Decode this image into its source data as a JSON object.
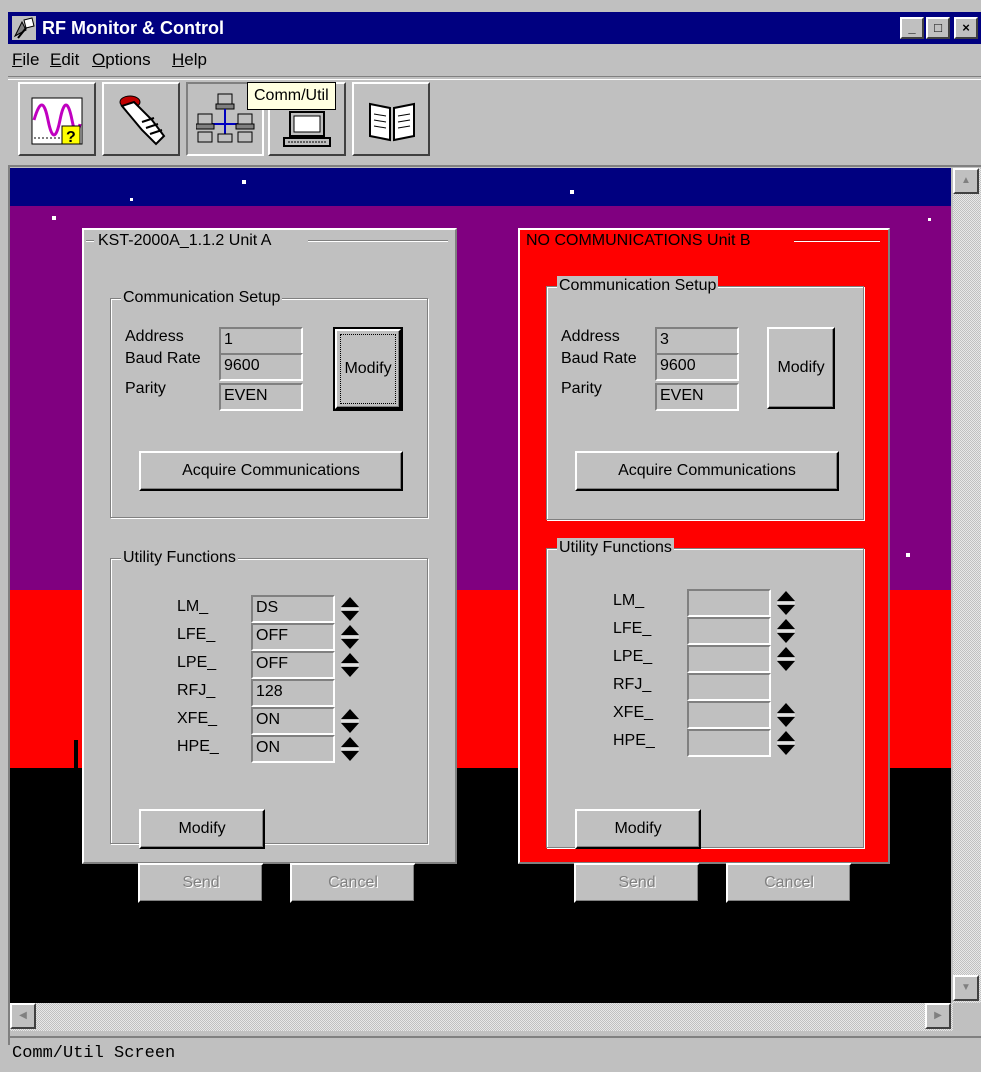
{
  "window": {
    "title": "RF Monitor & Control",
    "min_glyph": "_",
    "max_glyph": "□",
    "close_glyph": "×"
  },
  "menu": [
    {
      "label": "File",
      "accel": "F",
      "rest": "ile"
    },
    {
      "label": "Edit",
      "accel": "E",
      "rest": "dit"
    },
    {
      "label": "Options",
      "accel": "O",
      "rest": "ptions"
    },
    {
      "label": "Help",
      "accel": "H",
      "rest": "elp"
    }
  ],
  "toolbar": {
    "buttons": [
      {
        "name": "waveform-help",
        "icon": "waveform-question-icon"
      },
      {
        "name": "hand-control",
        "icon": "hand-pointer-icon"
      },
      {
        "name": "comm-util",
        "icon": "network-computers-icon",
        "pressed": true
      },
      {
        "name": "computer",
        "icon": "computer-terminal-icon"
      },
      {
        "name": "book",
        "icon": "open-book-icon"
      }
    ],
    "tooltip": "Comm/Util"
  },
  "units": {
    "a": {
      "title": "KST-2000A_1.1.2 Unit A",
      "comm": {
        "group_title": "Communication Setup",
        "address_label": "Address",
        "address": "1",
        "baud_label": "Baud Rate",
        "baud": "9600",
        "parity_label": "Parity",
        "parity": "EVEN",
        "modify": "Modify",
        "acquire": "Acquire Communications"
      },
      "util": {
        "group_title": "Utility Functions",
        "rows": [
          {
            "label": "LM_",
            "value": "DS",
            "spin": true
          },
          {
            "label": "LFE_",
            "value": "OFF",
            "spin": true
          },
          {
            "label": "LPE_",
            "value": "OFF",
            "spin": true
          },
          {
            "label": "RFJ_",
            "value": "128",
            "spin": false
          },
          {
            "label": "XFE_",
            "value": "ON",
            "spin": true
          },
          {
            "label": "HPE_",
            "value": "ON",
            "spin": true
          }
        ],
        "modify": "Modify",
        "send": "Send",
        "cancel": "Cancel"
      }
    },
    "b": {
      "title": "NO COMMUNICATIONS Unit B",
      "comm": {
        "group_title": "Communication Setup",
        "address_label": "Address",
        "address": "3",
        "baud_label": "Baud Rate",
        "baud": "9600",
        "parity_label": "Parity",
        "parity": "EVEN",
        "modify": "Modify",
        "acquire": "Acquire Communications"
      },
      "util": {
        "group_title": "Utility Functions",
        "rows": [
          {
            "label": "LM_",
            "value": "",
            "spin": true
          },
          {
            "label": "LFE_",
            "value": "",
            "spin": true
          },
          {
            "label": "LPE_",
            "value": "",
            "spin": true
          },
          {
            "label": "RFJ_",
            "value": "",
            "spin": false
          },
          {
            "label": "XFE_",
            "value": "",
            "spin": true
          },
          {
            "label": "HPE_",
            "value": "",
            "spin": true
          }
        ],
        "modify": "Modify",
        "send": "Send",
        "cancel": "Cancel"
      }
    }
  },
  "status": "Comm/Util Screen",
  "colors": {
    "title_bar": "#000080",
    "sky": "#800080",
    "ground": "#ff0000",
    "alarm": "#ff0000",
    "face": "#c0c0c0"
  }
}
